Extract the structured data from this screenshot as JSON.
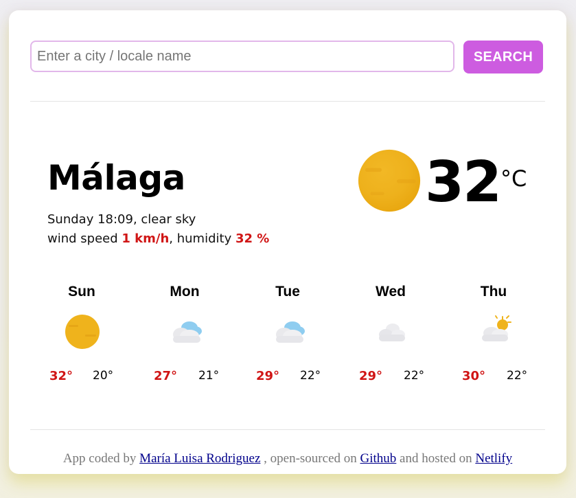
{
  "search": {
    "placeholder": "Enter a city / locale name",
    "value": "",
    "button_label": "SEARCH"
  },
  "current": {
    "city": "Málaga",
    "datetime_desc": "Sunday 18:09, clear sky",
    "wind_prefix": "wind speed ",
    "wind_value": "1 km/h",
    "humidity_prefix": ", humidity ",
    "humidity_value": "32 %",
    "temperature": "32",
    "unit": "°C",
    "icon": "sun-icon"
  },
  "forecast": [
    {
      "day": "Sun",
      "max": "32°",
      "min": "20°",
      "icon": "sun-icon"
    },
    {
      "day": "Mon",
      "max": "27°",
      "min": "21°",
      "icon": "cloud-icon"
    },
    {
      "day": "Tue",
      "max": "29°",
      "min": "22°",
      "icon": "cloud-icon"
    },
    {
      "day": "Wed",
      "max": "29°",
      "min": "22°",
      "icon": "cloud-icon"
    },
    {
      "day": "Thu",
      "max": "30°",
      "min": "22°",
      "icon": "partly-cloudy-icon"
    }
  ],
  "footer": {
    "prefix": "App coded by ",
    "author": "María Luisa Rodriguez",
    "middle": " , open-sourced on ",
    "github": "Github",
    "middle2": " and hosted on ",
    "netlify": "Netlify"
  },
  "colors": {
    "accent": "#cd5ce0",
    "highlight": "#d01515",
    "input_border": "#e2b7ea"
  }
}
